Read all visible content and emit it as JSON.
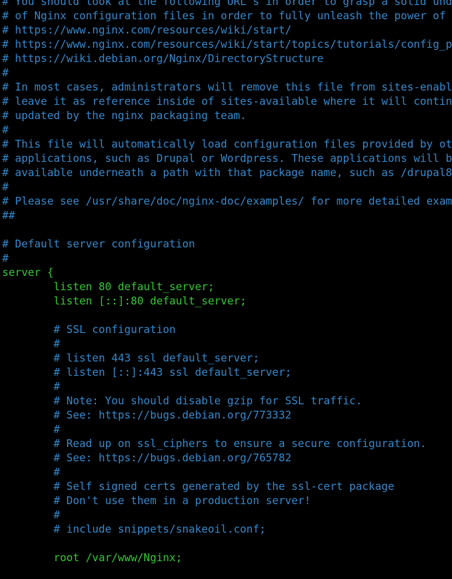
{
  "terminal": {
    "colors": {
      "background": "#000000",
      "comment": "#2f86c8",
      "code": "#2fc42f"
    },
    "lines": [
      {
        "type": "comment",
        "text": "# You should look at the following URL's in order to grasp a solid unde"
      },
      {
        "type": "comment",
        "text": "# of Nginx configuration files in order to fully unleash the power of N"
      },
      {
        "type": "comment",
        "text": "# https://www.nginx.com/resources/wiki/start/"
      },
      {
        "type": "comment",
        "text": "# https://www.nginx.com/resources/wiki/start/topics/tutorials/config_pi"
      },
      {
        "type": "comment",
        "text": "# https://wiki.debian.org/Nginx/DirectoryStructure"
      },
      {
        "type": "comment",
        "text": "#"
      },
      {
        "type": "comment",
        "text": "# In most cases, administrators will remove this file from sites-enable"
      },
      {
        "type": "comment",
        "text": "# leave it as reference inside of sites-available where it will continu"
      },
      {
        "type": "comment",
        "text": "# updated by the nginx packaging team."
      },
      {
        "type": "comment",
        "text": "#"
      },
      {
        "type": "comment",
        "text": "# This file will automatically load configuration files provided by oth"
      },
      {
        "type": "comment",
        "text": "# applications, such as Drupal or Wordpress. These applications will be"
      },
      {
        "type": "comment",
        "text": "# available underneath a path with that package name, such as /drupal8"
      },
      {
        "type": "comment",
        "text": "#"
      },
      {
        "type": "comment",
        "text": "# Please see /usr/share/doc/nginx-doc/examples/ for more detailed examp"
      },
      {
        "type": "comment",
        "text": "##"
      },
      {
        "type": "blank",
        "text": ""
      },
      {
        "type": "comment",
        "text": "# Default server configuration"
      },
      {
        "type": "comment",
        "text": "#"
      },
      {
        "type": "code",
        "text": "server {"
      },
      {
        "type": "code",
        "text": "        listen 80 default_server;"
      },
      {
        "type": "code",
        "text": "        listen [::]:80 default_server;"
      },
      {
        "type": "blank",
        "text": ""
      },
      {
        "type": "comment",
        "text": "        # SSL configuration"
      },
      {
        "type": "comment",
        "text": "        #"
      },
      {
        "type": "comment",
        "text": "        # listen 443 ssl default_server;"
      },
      {
        "type": "comment",
        "text": "        # listen [::]:443 ssl default_server;"
      },
      {
        "type": "comment",
        "text": "        #"
      },
      {
        "type": "comment",
        "text": "        # Note: You should disable gzip for SSL traffic."
      },
      {
        "type": "comment",
        "text": "        # See: https://bugs.debian.org/773332"
      },
      {
        "type": "comment",
        "text": "        #"
      },
      {
        "type": "comment",
        "text": "        # Read up on ssl_ciphers to ensure a secure configuration."
      },
      {
        "type": "comment",
        "text": "        # See: https://bugs.debian.org/765782"
      },
      {
        "type": "comment",
        "text": "        #"
      },
      {
        "type": "comment",
        "text": "        # Self signed certs generated by the ssl-cert package"
      },
      {
        "type": "comment",
        "text": "        # Don't use them in a production server!"
      },
      {
        "type": "comment",
        "text": "        #"
      },
      {
        "type": "comment",
        "text": "        # include snippets/snakeoil.conf;"
      },
      {
        "type": "blank",
        "text": ""
      },
      {
        "type": "code",
        "text": "        root /var/www/Nginx;"
      },
      {
        "type": "blank",
        "text": ""
      }
    ]
  }
}
